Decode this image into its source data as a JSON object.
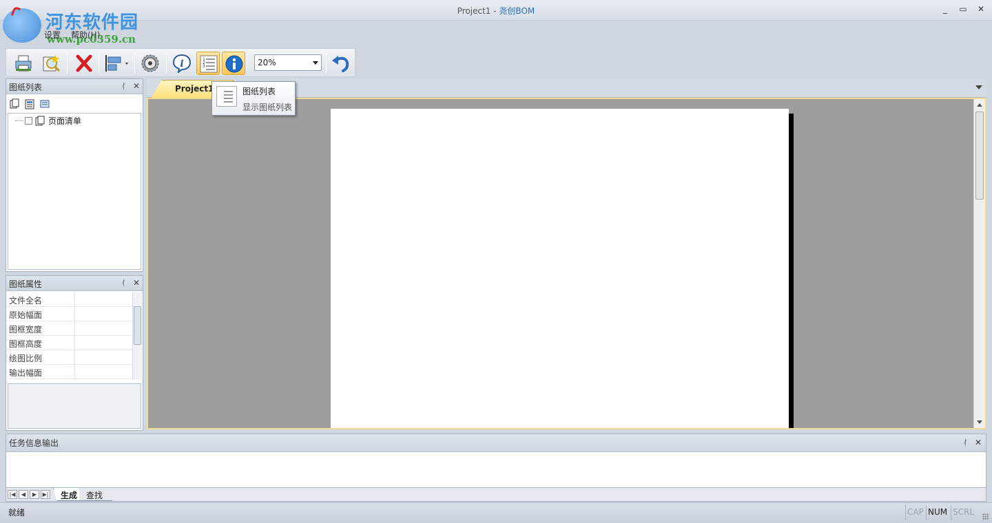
{
  "window": {
    "title_project": "Project1",
    "title_sep": " - ",
    "title_app": "尧创BOM",
    "buttons": [
      "_",
      "▭",
      "✕"
    ]
  },
  "watermark": {
    "name": "河东软件园",
    "url": "www.pc0359.cn"
  },
  "menu": {
    "items": [
      "设置",
      "帮助(H)"
    ]
  },
  "toolbar": {
    "buttons": [
      {
        "name": "print-icon"
      },
      {
        "name": "preview-icon"
      },
      {
        "name": "delete-icon"
      },
      {
        "name": "layout-icon"
      },
      {
        "name": "settings-disc-icon"
      },
      {
        "name": "info-bubble-icon"
      },
      {
        "name": "drawing-list-icon",
        "active": true
      },
      {
        "name": "info-icon",
        "active": true
      },
      {
        "name": "undo-icon"
      }
    ],
    "zoom_value": "20%"
  },
  "tooltip": {
    "title": "图纸列表",
    "description": "显示图纸列表"
  },
  "list_panel": {
    "title": "图纸列表",
    "pin": "ᚰ",
    "close": "✕",
    "tree_item": "页面清单"
  },
  "prop_panel": {
    "title": "图纸属性",
    "pin": "ᚰ",
    "close": "✕",
    "rows": [
      "文件全名",
      "原始幅面",
      "图框宽度",
      "图框高度",
      "绘图比例",
      "输出幅面"
    ]
  },
  "document": {
    "tab_label": "Project1"
  },
  "output_panel": {
    "title": "任务信息输出",
    "pin": "ᚰ",
    "close": "✕",
    "tabs": [
      "生成",
      "查找"
    ]
  },
  "status": {
    "text": "就绪",
    "indicators": [
      {
        "label": "CAP",
        "on": false
      },
      {
        "label": "NUM",
        "on": true
      },
      {
        "label": "SCRL",
        "on": false
      }
    ]
  },
  "colors": {
    "accent": "#2f6bb3",
    "active_button": "#ffc85a",
    "canvas_bg": "#9e9e9e"
  }
}
